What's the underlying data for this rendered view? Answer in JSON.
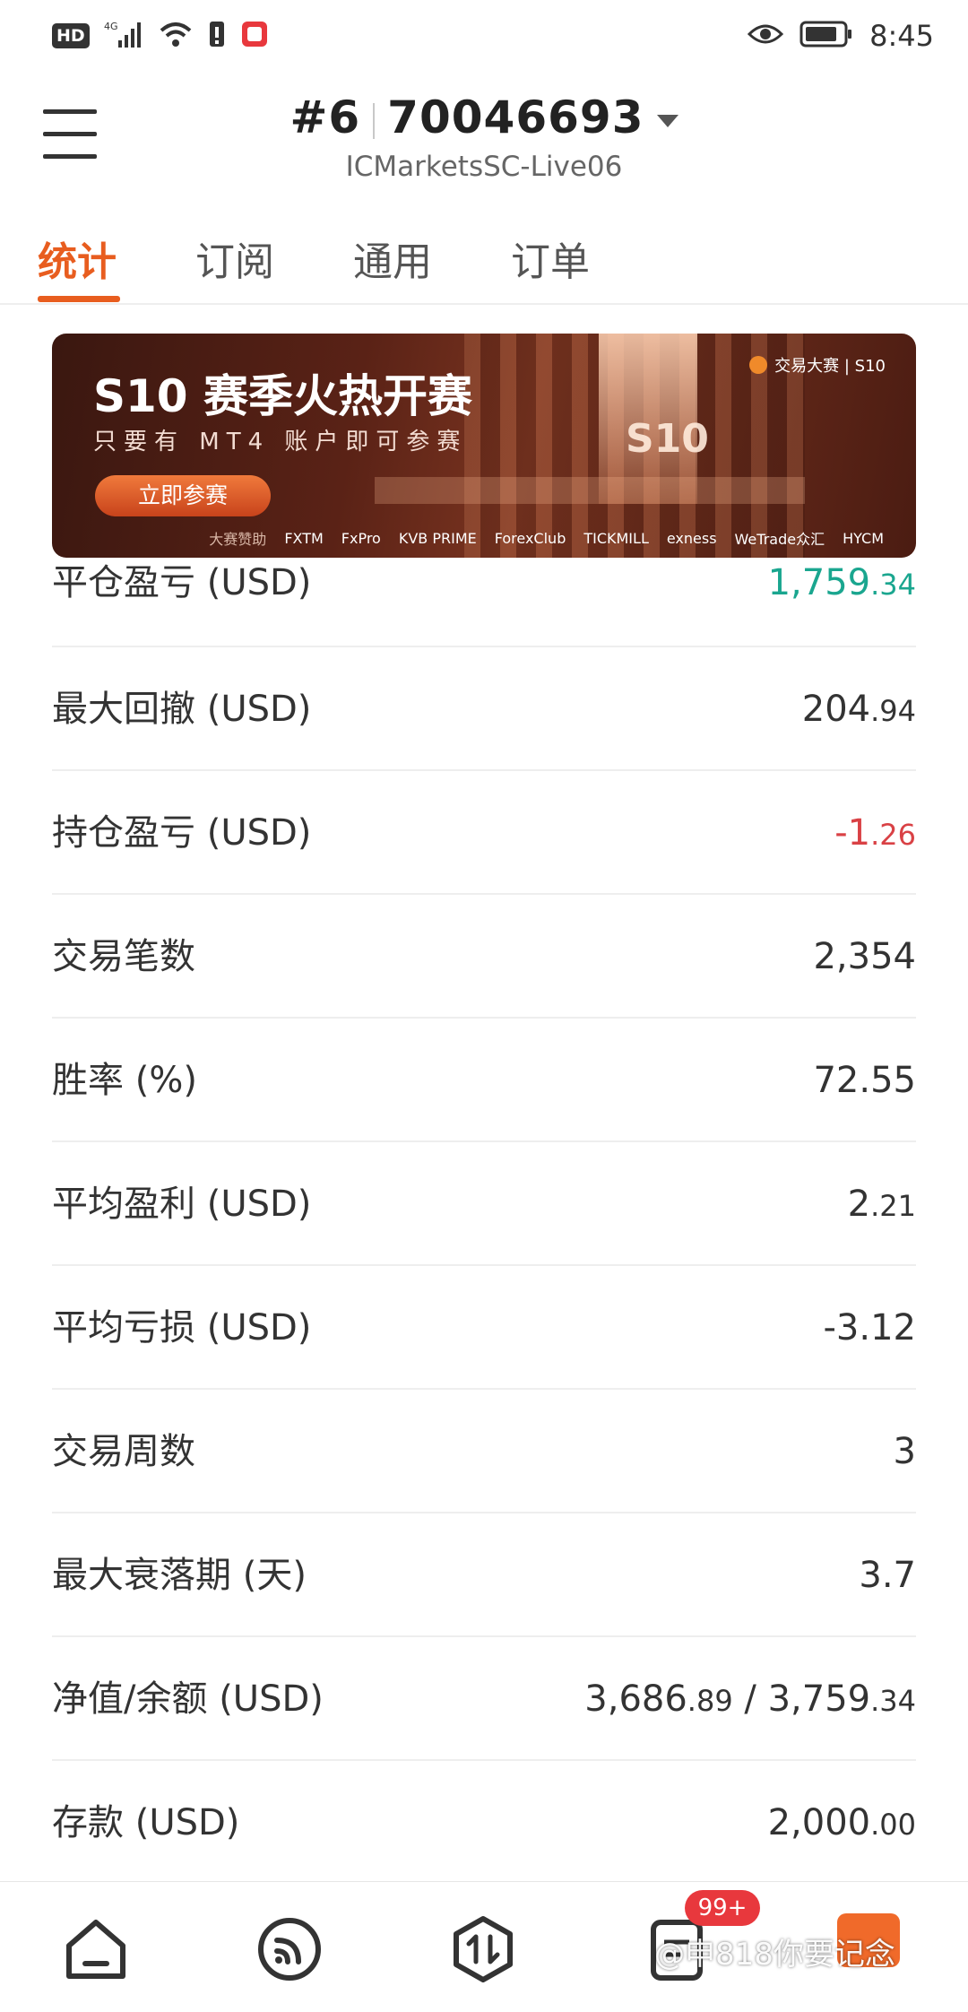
{
  "status_bar": {
    "hd": "HD",
    "network": "4G",
    "time": "8:45"
  },
  "header": {
    "account_index": "#6",
    "account_number": "70046693",
    "server": "ICMarketsSC-Live06"
  },
  "tabs": [
    {
      "label": "统计",
      "active": true
    },
    {
      "label": "订阅",
      "active": false
    },
    {
      "label": "通用",
      "active": false
    },
    {
      "label": "订单",
      "active": false
    }
  ],
  "banner": {
    "title": "S10 赛季火热开赛",
    "subtitle": "只要有 MT4 账户即可参赛",
    "button": "立即参赛",
    "big_text": "S10",
    "brand": "交易大赛 | S10",
    "sponsors_label": "大赛赞助",
    "sponsors": [
      "FXTM",
      "FxPro",
      "KVB PRIME",
      "ForexClub",
      "TICKMILL",
      "exness",
      "WeTrade众汇",
      "HYCM"
    ]
  },
  "stats": [
    {
      "label": "平仓盈亏 (USD)",
      "int": "1,759",
      "dec": ".34",
      "color": "green"
    },
    {
      "label": "最大回撤 (USD)",
      "int": "204",
      "dec": ".94",
      "color": ""
    },
    {
      "label": "持仓盈亏 (USD)",
      "int": "-1",
      "dec": ".26",
      "color": "red"
    },
    {
      "label": "交易笔数",
      "int": "2,354",
      "dec": "",
      "color": ""
    },
    {
      "label": "胜率 (%)",
      "int": "72.55",
      "dec": "",
      "color": ""
    },
    {
      "label": "平均盈利 (USD)",
      "int": "2",
      "dec": ".21",
      "color": ""
    },
    {
      "label": "平均亏损 (USD)",
      "int": "-3.12",
      "dec": "",
      "color": ""
    },
    {
      "label": "交易周数",
      "int": "3",
      "dec": "",
      "color": ""
    },
    {
      "label": "最大衰落期 (天)",
      "int": "3.7",
      "dec": "",
      "color": ""
    },
    {
      "label": "净值/余额 (USD)",
      "int": "3,686",
      "dec": ".89",
      "int2": " / 3,759",
      "dec2": ".34",
      "color": ""
    },
    {
      "label": "存款 (USD)",
      "int": "2,000",
      "dec": ".00",
      "color": ""
    }
  ],
  "bottom_nav": {
    "badge": "99+",
    "watermark": "@申818你要记念",
    "icons": [
      "home-icon",
      "signal-feed-icon",
      "trade-icon",
      "orders-icon",
      "profile-icon"
    ]
  },
  "colors": {
    "accent": "#e85d1f",
    "profit": "#1aa68f",
    "loss": "#d94145"
  }
}
